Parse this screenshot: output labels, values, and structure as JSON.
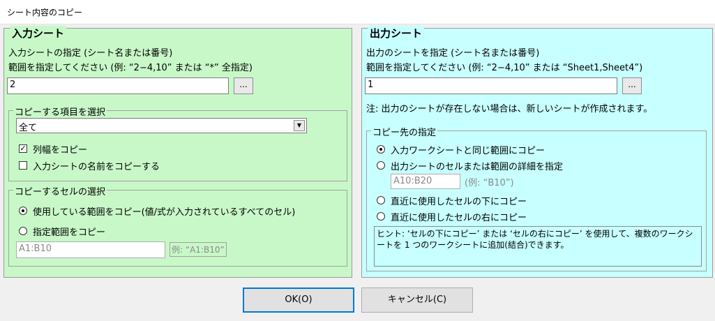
{
  "window": {
    "title": "シート内容のコピー"
  },
  "input_sheet": {
    "legend": "入力シート",
    "instruction_1": "入力シートの指定 (シート名または番号)",
    "instruction_2": "範囲を指定してください (例: “2−4,10” または “*” 全指定)",
    "value": "2",
    "browse_label": "...",
    "copy_items": {
      "legend": "コピーする項目を選択",
      "selected": "全て",
      "col_width_label": "列幅をコピー",
      "col_width_checked": true,
      "copy_name_label": "入力シートの名前をコピーする",
      "copy_name_checked": false
    },
    "cell_selection": {
      "legend": "コピーするセルの選択",
      "used_range_label": "使用している範囲をコピー(値/式が入力されているすべてのセル)",
      "specified_range_label": "指定範囲をコピー",
      "range_value": "A1:B10",
      "range_example": "例: “A1:B10”"
    }
  },
  "output_sheet": {
    "legend": "出力シート",
    "instruction_1": "出力のシートを指定 (シート名または番号)",
    "instruction_2": "範囲を指定してください (例: “2−4,10” または “Sheet1,Sheet4”)",
    "value": "1",
    "browse_label": "...",
    "note": "注: 出力のシートが存在しない場合は、新しいシートが作成されます。",
    "destination": {
      "legend": "コピー先の指定",
      "opt_same_range": "入力ワークシートと同じ範囲にコピー",
      "opt_specify_cell": "出力シートのセルまたは範囲の詳細を指定",
      "cell_value": "A10:B20",
      "cell_example": "(例: “B10”)",
      "opt_below": "直近に使用したセルの下にコピー",
      "opt_right": "直近に使用したセルの右にコピー",
      "hint": "ヒント: ‘セルの下にコピー’ または ‘セルの右にコピー’ を使用して、複数のワークシートを 1 つのワークシートに追加(結合)できます。"
    }
  },
  "buttons": {
    "ok": "OK(O)",
    "cancel": "キャンセル(C)"
  }
}
